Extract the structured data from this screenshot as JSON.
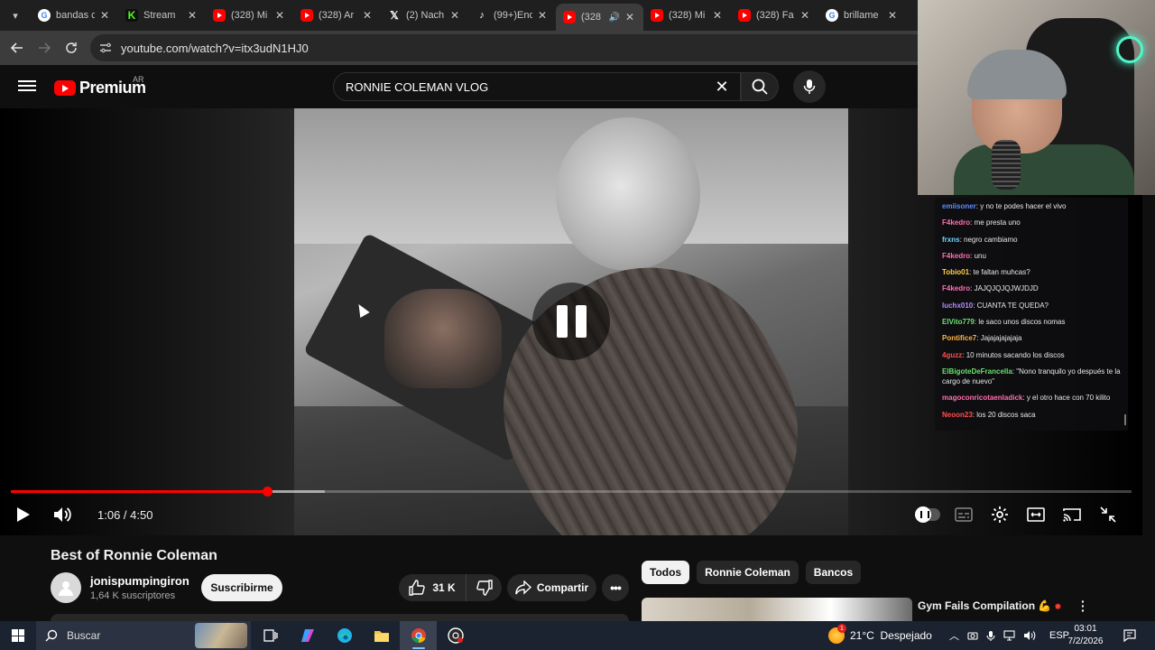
{
  "browser": {
    "tabs": [
      {
        "icon": "google-icon",
        "title": "bandas c",
        "active": false
      },
      {
        "icon": "kick-icon",
        "title": "Stream",
        "active": false
      },
      {
        "icon": "youtube-icon",
        "title": "(328) Mi",
        "active": false
      },
      {
        "icon": "youtube-icon",
        "title": "(328) Ar",
        "active": false
      },
      {
        "icon": "x-icon",
        "title": "(2) Nach",
        "active": false
      },
      {
        "icon": "tiktok-icon",
        "title": "(99+)Enc",
        "active": false
      },
      {
        "icon": "youtube-icon",
        "title": "(328",
        "active": true
      },
      {
        "icon": "youtube-icon",
        "title": "(328) Mi",
        "active": false
      },
      {
        "icon": "youtube-icon",
        "title": "(328) Fa",
        "active": false
      },
      {
        "icon": "google-icon",
        "title": "brillame",
        "active": false
      }
    ],
    "url": "youtube.com/watch?v=itx3udN1HJ0"
  },
  "youtube": {
    "logo_text": "Premium",
    "country": "AR",
    "search_query": "RONNIE COLEMAN VLOG"
  },
  "player": {
    "time_current": "1:06",
    "time_separator": " / ",
    "time_total": "4:50",
    "progress_played": 0.229,
    "progress_buffered": 0.28,
    "state": "paused",
    "accent_color": "#ff0000"
  },
  "video": {
    "title": "Best of Ronnie Coleman",
    "channel": "jonispumpingiron",
    "subscribers": "1,64 K suscriptores",
    "subscribe_label": "Suscribirme",
    "likes": "31 K",
    "share_label": "Compartir"
  },
  "chips": [
    "Todos",
    "Ronnie Coleman",
    "Bancos"
  ],
  "recommendation": {
    "title": "Gym Fails Compilation",
    "emoji": "💪",
    "badge": "✸"
  },
  "chat": [
    {
      "user": "emiisoner",
      "color": "#5b8cff",
      "text": "y no te podes hacer el vivo"
    },
    {
      "user": "F4kedro",
      "color": "#ff6fae",
      "text": "me presta uno"
    },
    {
      "user": "frxns",
      "color": "#6fd3ff",
      "text": "negro cambiamo"
    },
    {
      "user": "F4kedro",
      "color": "#ff6fae",
      "text": "unu"
    },
    {
      "user": "Tobio01",
      "color": "#ffd24d",
      "text": "te faltan muhcas?"
    },
    {
      "user": "F4kedro",
      "color": "#ff6fae",
      "text": "JAJQJQJQJWJDJD"
    },
    {
      "user": "luchx010",
      "color": "#b38cff",
      "text": "CUANTA TE QUEDA?"
    },
    {
      "user": "ElVito779",
      "color": "#6be36b",
      "text": "le saco unos discos nomas"
    },
    {
      "user": "Pontifice7",
      "color": "#ffb347",
      "text": "Jajajajajajaja"
    },
    {
      "user": "4guzz",
      "color": "#ff4d4d",
      "text": "10 minutos sacando los discos"
    },
    {
      "user": "ElBigoteDeFrancella",
      "color": "#6be36b",
      "text": "\"Nono tranquilo yo después te la cargo de nuevo\""
    },
    {
      "user": "magoconricotaenladick",
      "color": "#ff6fae",
      "text": "y el otro hace con 70 kilito"
    },
    {
      "user": "Neoon23",
      "color": "#ff4d4d",
      "text": "los 20 discos saca"
    }
  ],
  "taskbar": {
    "search_placeholder": "Buscar",
    "weather": "21°C  Despejado",
    "weather_badge": "1",
    "language": "ESP",
    "time": "03:01",
    "date": "7/2/2026"
  }
}
